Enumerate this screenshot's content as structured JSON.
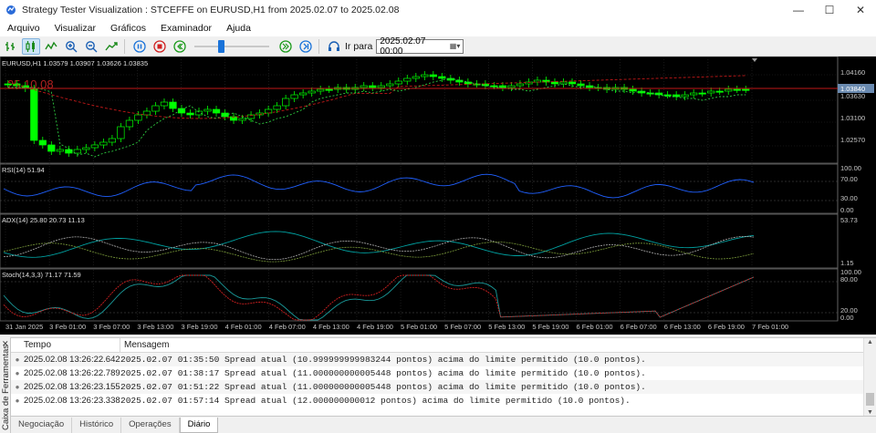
{
  "window": {
    "title": "Strategy Tester Visualization : STCEFFE on EURUSD,H1 from 2025.02.07 to 2025.02.08",
    "minimize": "—",
    "maximize": "☐",
    "close": "✕"
  },
  "menu": [
    "Arquivo",
    "Visualizar",
    "Gráficos",
    "Examinador",
    "Ajuda"
  ],
  "toolbar": {
    "goto_label": "Ir para",
    "goto_date": "2025.02.07 00:00",
    "speed_level": 0.35
  },
  "chart_data": {
    "type": "candlestick",
    "symbol_info": "EURUSD,H1  1.03579  1.03907  1.03626  1.03835",
    "watermark": "25.10.08",
    "price_axis": [
      "1.04160",
      "1.03630",
      "1.03100",
      "1.02570"
    ],
    "current_price": "1.03840",
    "rsi": {
      "label": "RSI(14) 51.94",
      "axis": [
        "100.00",
        "70.00",
        "30.00",
        "0.00"
      ]
    },
    "adx": {
      "label": "ADX(14) 25.80 20.73 11.13",
      "axis": [
        "53.73",
        "1.15"
      ]
    },
    "stoch": {
      "label": "Stoch(14,3,3) 71.17 71.59",
      "axis": [
        "100.00",
        "80.00",
        "20.00",
        "0.00"
      ]
    },
    "time_axis": [
      "31 Jan 2025",
      "3 Feb 01:00",
      "3 Feb 07:00",
      "3 Feb 13:00",
      "3 Feb 19:00",
      "4 Feb 01:00",
      "4 Feb 07:00",
      "4 Feb 13:00",
      "4 Feb 19:00",
      "5 Feb 01:00",
      "5 Feb 07:00",
      "5 Feb 13:00",
      "5 Feb 19:00",
      "6 Feb 01:00",
      "6 Feb 07:00",
      "6 Feb 13:00",
      "6 Feb 19:00",
      "7 Feb 01:00"
    ]
  },
  "toolbox": {
    "label": "Caixa de Ferramentas",
    "close": "✕"
  },
  "log": {
    "headers": {
      "time": "Tempo",
      "message": "Mensagem"
    },
    "rows": [
      {
        "time": "2025.02.08 13:26:22.642",
        "message": "2025.02.07 01:35:50   Spread atual (10.999999999983244 pontos) acima do limite permitido (10.0 pontos)."
      },
      {
        "time": "2025.02.08 13:26:22.789",
        "message": "2025.02.07 01:38:17   Spread atual (11.000000000005448 pontos) acima do limite permitido (10.0 pontos)."
      },
      {
        "time": "2025.02.08 13:26:23.155",
        "message": "2025.02.07 01:51:22   Spread atual (11.000000000005448 pontos) acima do limite permitido (10.0 pontos)."
      },
      {
        "time": "2025.02.08 13:26:23.338",
        "message": "2025.02.07 01:57:14   Spread atual (12.000000000012 pontos) acima do limite permitido (10.0 pontos)."
      }
    ]
  },
  "tabs": [
    "Negociação",
    "Histórico",
    "Operações",
    "Diário"
  ],
  "active_tab": 3,
  "colors": {
    "bull": "#00ff00",
    "bear": "#000000",
    "grid": "#2a2a2a",
    "ma_red": "#c01818",
    "ma_green": "#2ecc40",
    "rsi_line": "#2060ff",
    "adx_main": "#00a0a0",
    "stoch_main": "#1a9a9a",
    "stoch_signal": "#d02020"
  }
}
